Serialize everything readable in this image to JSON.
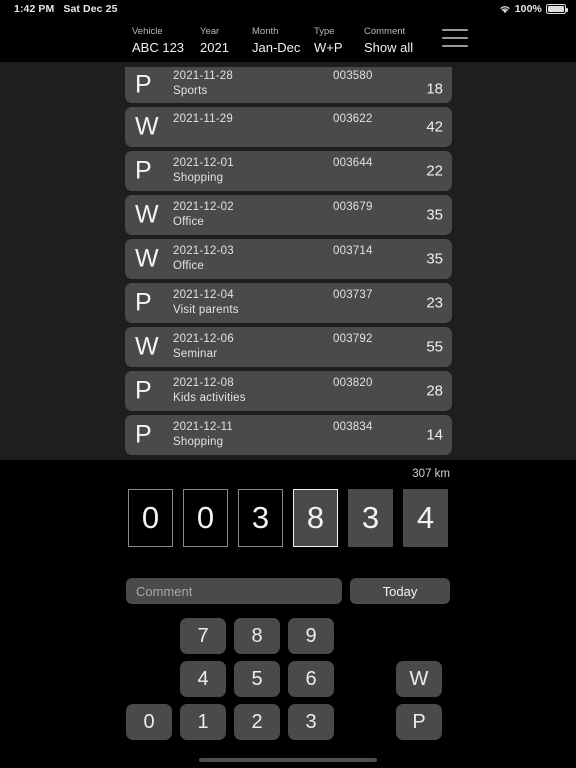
{
  "status_bar": {
    "time": "1:42 PM",
    "date": "Sat Dec 25",
    "battery_percent": "100%",
    "wifi_icon": "wifi-icon",
    "battery_icon": "battery-icon"
  },
  "toolbar": {
    "fields": [
      {
        "label": "Vehicle",
        "value": "ABC 123"
      },
      {
        "label": "Year",
        "value": "2021"
      },
      {
        "label": "Month",
        "value": "Jan-Dec"
      },
      {
        "label": "Type",
        "value": "W+P"
      },
      {
        "label": "Comment",
        "value": "Show all"
      }
    ],
    "menu_icon": "hamburger-menu-icon"
  },
  "trip_list": {
    "rows": [
      {
        "type": "P",
        "date": "2021-11-28",
        "comment": "Sports",
        "odometer": "003580",
        "distance": "18"
      },
      {
        "type": "W",
        "date": "2021-11-29",
        "comment": "",
        "odometer": "003622",
        "distance": "42"
      },
      {
        "type": "P",
        "date": "2021-12-01",
        "comment": "Shopping",
        "odometer": "003644",
        "distance": "22"
      },
      {
        "type": "W",
        "date": "2021-12-02",
        "comment": "Office",
        "odometer": "003679",
        "distance": "35"
      },
      {
        "type": "W",
        "date": "2021-12-03",
        "comment": "Office",
        "odometer": "003714",
        "distance": "35"
      },
      {
        "type": "P",
        "date": "2021-12-04",
        "comment": "Visit parents",
        "odometer": "003737",
        "distance": "23"
      },
      {
        "type": "W",
        "date": "2021-12-06",
        "comment": "Seminar",
        "odometer": "003792",
        "distance": "55"
      },
      {
        "type": "P",
        "date": "2021-12-08",
        "comment": "Kids activities",
        "odometer": "003820",
        "distance": "28"
      },
      {
        "type": "P",
        "date": "2021-12-11",
        "comment": "Shopping",
        "odometer": "003834",
        "distance": "14"
      }
    ]
  },
  "odometer": {
    "distance_label": "307 km",
    "digits": [
      {
        "value": "0",
        "state": "lead"
      },
      {
        "value": "0",
        "state": "lead"
      },
      {
        "value": "3",
        "state": "lead"
      },
      {
        "value": "8",
        "state": "active"
      },
      {
        "value": "3",
        "state": "plain"
      },
      {
        "value": "4",
        "state": "plain"
      }
    ]
  },
  "entry": {
    "comment_value": "",
    "comment_placeholder": "Comment",
    "today_label": "Today"
  },
  "keypad": {
    "row1": [
      "7",
      "8",
      "9"
    ],
    "row2": [
      "4",
      "5",
      "6"
    ],
    "row3": [
      "0",
      "1",
      "2",
      "3"
    ],
    "work_key": "W",
    "private_key": "P"
  },
  "colors": {
    "background": "#000000",
    "list_background": "#1e1e1e",
    "surface": "#4a4a4a",
    "text_primary": "#f2f2f2",
    "text_secondary": "#b9b9b9",
    "selection_border": "#f2f2f2"
  }
}
